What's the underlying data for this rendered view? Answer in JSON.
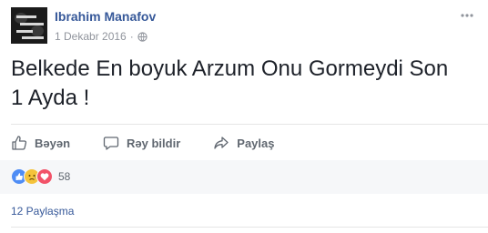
{
  "post": {
    "author": "Ibrahim Manafov",
    "date": "1 Dekabr 2016",
    "separator": "·",
    "text": "Belkede En boyuk Arzum Onu Gormeydi Son 1 Ayda !"
  },
  "actions": {
    "like": "Bəyən",
    "comment": "Rəy bildir",
    "share": "Paylaş"
  },
  "reactions": {
    "types": [
      "like",
      "sad",
      "love"
    ],
    "count": "58"
  },
  "shares": "12 Paylaşma",
  "icons": {
    "avatar": "avatar-image",
    "privacy": "globe-icon",
    "more": "more-options-icon"
  },
  "colors": {
    "link": "#365899",
    "muted": "#90949c",
    "action": "#606770",
    "like_reaction": "#4f8df5",
    "sad_reaction": "#f5c33b",
    "love_reaction": "#f25268"
  }
}
